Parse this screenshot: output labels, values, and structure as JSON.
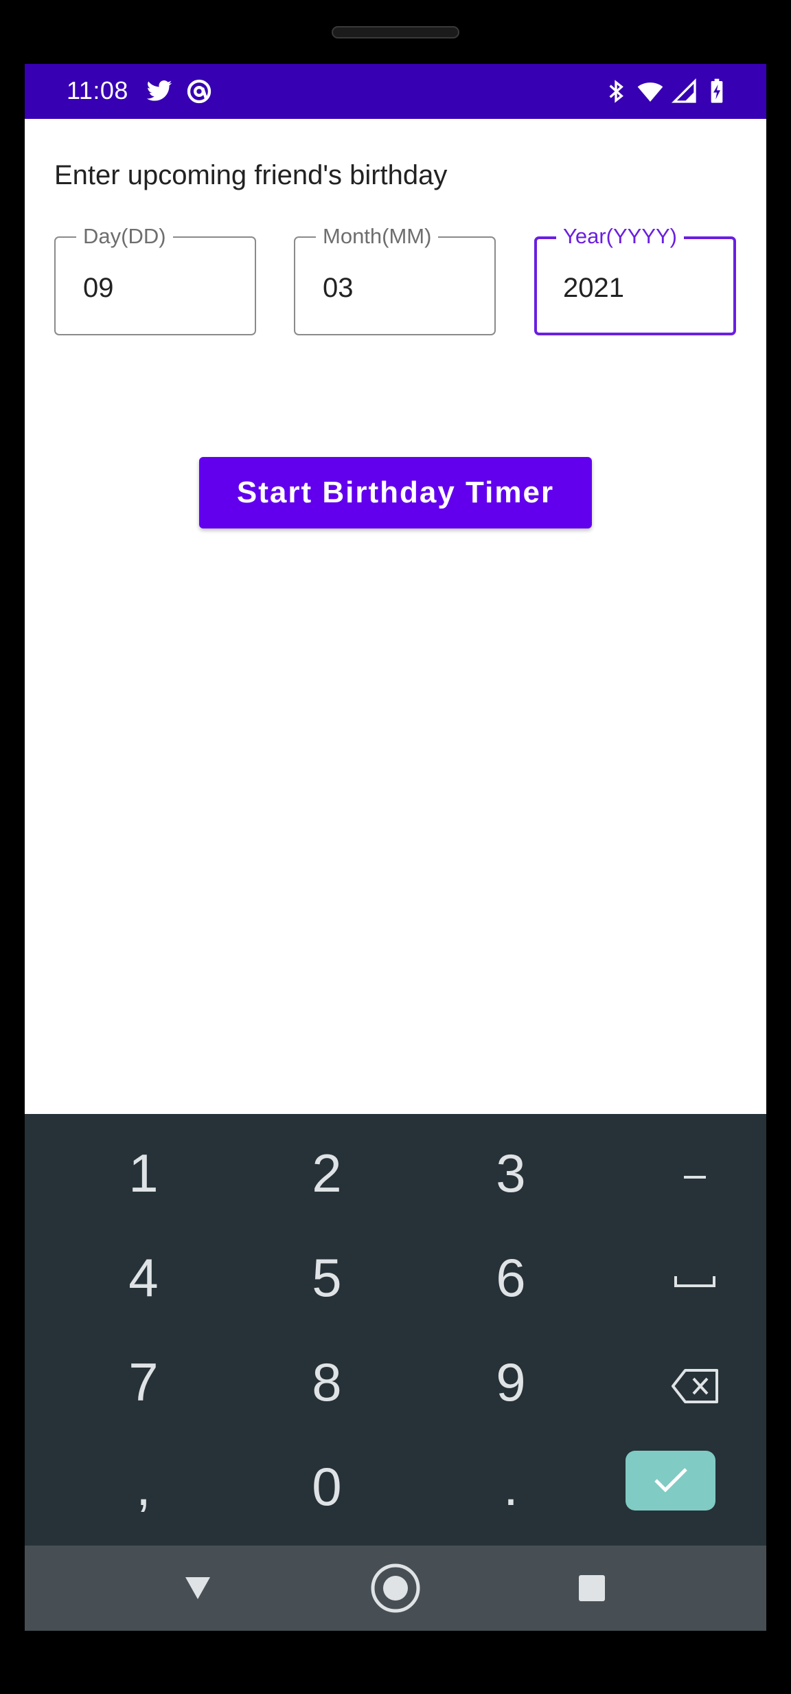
{
  "status_bar": {
    "time": "11:08",
    "left_icons": [
      "twitter-icon",
      "at-sign-icon"
    ],
    "right_icons": [
      "bluetooth-icon",
      "wifi-icon",
      "signal-icon",
      "battery-charging-icon"
    ],
    "background": "#3700b3"
  },
  "content": {
    "prompt": "Enter upcoming friend's birthday",
    "fields": [
      {
        "label": "Day(DD)",
        "value": "09",
        "focused": false
      },
      {
        "label": "Month(MM)",
        "value": "03",
        "focused": false
      },
      {
        "label": "Year(YYYY)",
        "value": "2021",
        "focused": true
      }
    ],
    "start_button_label": "Start Birthday Timer",
    "accent_color": "#6200ee"
  },
  "keyboard": {
    "rows": [
      [
        "1",
        "2",
        "3",
        "-"
      ],
      [
        "4",
        "5",
        "6",
        "space"
      ],
      [
        "7",
        "8",
        "9",
        "backspace"
      ],
      [
        ",",
        "0",
        ".",
        "done"
      ]
    ],
    "enter_key_color": "#80cbc4"
  },
  "nav_bar": {
    "buttons": [
      "back-icon",
      "home-icon",
      "recents-icon"
    ]
  }
}
